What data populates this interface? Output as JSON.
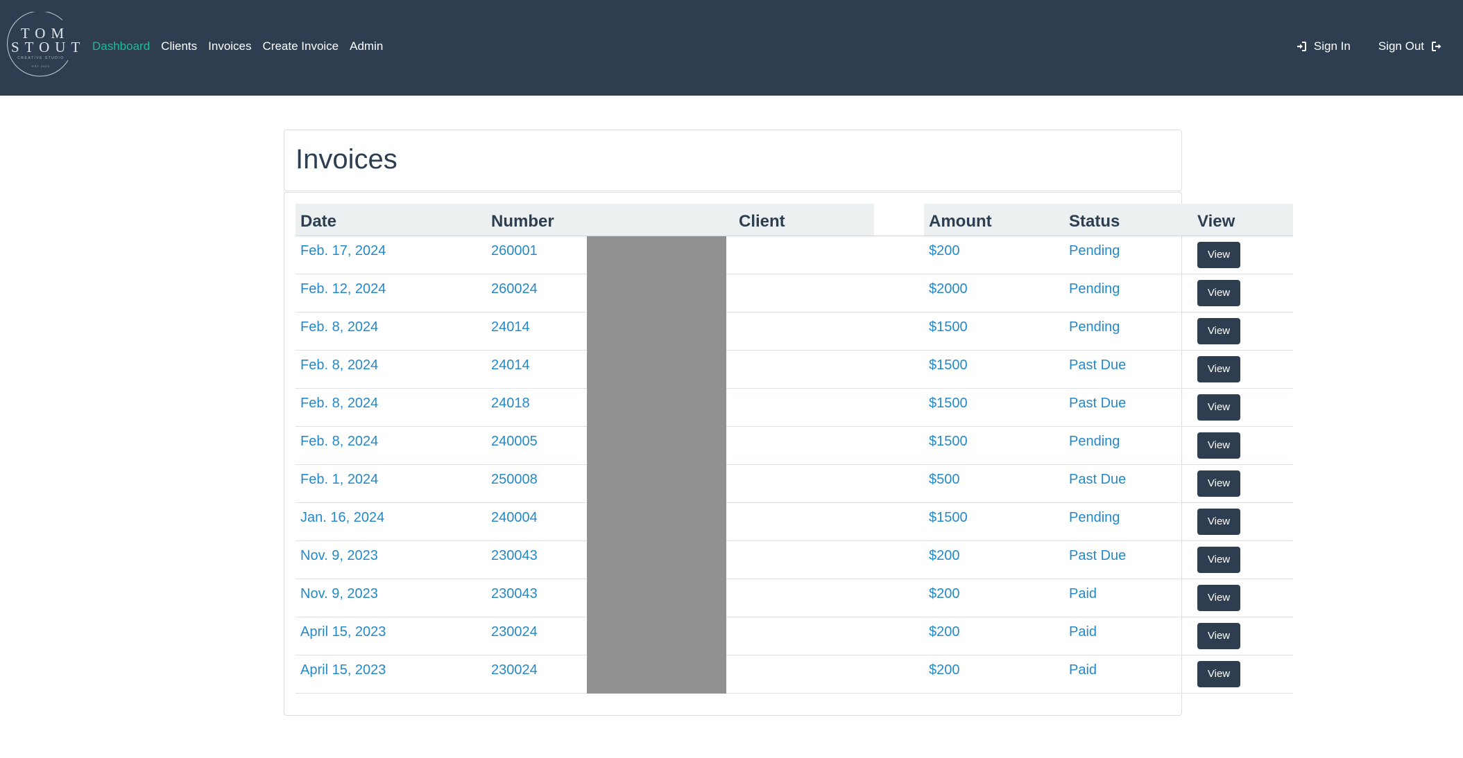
{
  "brand": {
    "line1": "TOM",
    "line2": "STOUT",
    "tagline": "CREATIVE STUDIO",
    "est": "EST 2023"
  },
  "nav": {
    "links": [
      {
        "label": "Dashboard",
        "active": true
      },
      {
        "label": "Clients",
        "active": false
      },
      {
        "label": "Invoices",
        "active": false
      },
      {
        "label": "Create Invoice",
        "active": false
      },
      {
        "label": "Admin",
        "active": false
      }
    ],
    "sign_in": "Sign In",
    "sign_out": "Sign Out"
  },
  "page": {
    "title": "Invoices"
  },
  "table": {
    "headers": {
      "date": "Date",
      "number": "Number",
      "client": "Client",
      "amount": "Amount",
      "status": "Status",
      "view": "View"
    },
    "rows": [
      {
        "date": "Feb. 17, 2024",
        "number": "260001",
        "amount": "$200",
        "status": "Pending",
        "view": "View"
      },
      {
        "date": "Feb. 12, 2024",
        "number": "260024",
        "amount": "$2000",
        "status": "Pending",
        "view": "View"
      },
      {
        "date": "Feb. 8, 2024",
        "number": "24014",
        "amount": "$1500",
        "status": "Pending",
        "view": "View"
      },
      {
        "date": "Feb. 8, 2024",
        "number": "24014",
        "amount": "$1500",
        "status": "Past Due",
        "view": "View"
      },
      {
        "date": "Feb. 8, 2024",
        "number": "24018",
        "amount": "$1500",
        "status": "Past Due",
        "view": "View"
      },
      {
        "date": "Feb. 8, 2024",
        "number": "240005",
        "amount": "$1500",
        "status": "Pending",
        "view": "View"
      },
      {
        "date": "Feb. 1, 2024",
        "number": "250008",
        "amount": "$500",
        "status": "Past Due",
        "view": "View"
      },
      {
        "date": "Jan. 16, 2024",
        "number": "240004",
        "amount": "$1500",
        "status": "Pending",
        "view": "View"
      },
      {
        "date": "Nov. 9, 2023",
        "number": "230043",
        "amount": "$200",
        "status": "Past Due",
        "view": "View"
      },
      {
        "date": "Nov. 9, 2023",
        "number": "230043",
        "amount": "$200",
        "status": "Paid",
        "view": "View"
      },
      {
        "date": "April 15, 2023",
        "number": "230024",
        "amount": "$200",
        "status": "Paid",
        "view": "View"
      },
      {
        "date": "April 15, 2023",
        "number": "230024",
        "amount": "$200",
        "status": "Paid",
        "view": "View"
      }
    ]
  },
  "colors": {
    "navbar_bg": "#2e3e50",
    "active_link": "#1abc9c",
    "link": "#2489c8",
    "header_bg": "#ecf0f1",
    "redaction": "#919191",
    "button_bg": "#2e3e50"
  },
  "icons": {
    "sign_in": "sign-in-icon",
    "sign_out": "sign-out-icon"
  }
}
